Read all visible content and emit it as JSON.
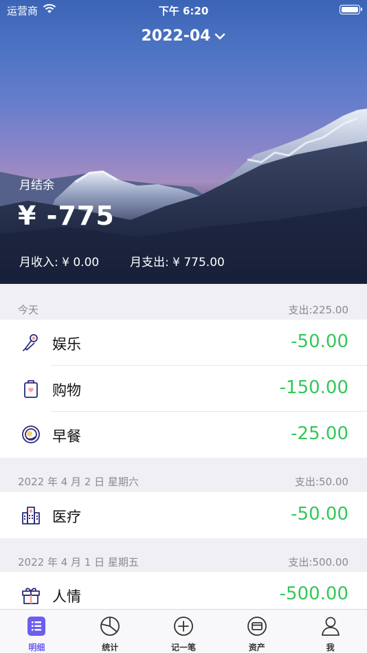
{
  "status_bar": {
    "carrier": "运营商",
    "time": "下午 6:20"
  },
  "header": {
    "month": "2022-04",
    "balance_label": "月结余",
    "balance_amount": "¥ -775",
    "income_text": "月收入: ¥ 0.00",
    "expense_text": "月支出: ¥ 775.00"
  },
  "sections": [
    {
      "date": "今天",
      "total": "支出:225.00",
      "rows": [
        {
          "icon": "microphone-icon",
          "name": "娱乐",
          "amount": "-50.00"
        },
        {
          "icon": "shopping-bag-icon",
          "name": "购物",
          "amount": "-150.00"
        },
        {
          "icon": "breakfast-plate-icon",
          "name": "早餐",
          "amount": "-25.00"
        }
      ]
    },
    {
      "date": "2022 年 4 月 2 日  星期六",
      "total": "支出:50.00",
      "rows": [
        {
          "icon": "hospital-icon",
          "name": "医疗",
          "amount": "-50.00"
        }
      ]
    },
    {
      "date": "2022 年 4 月 1 日  星期五",
      "total": "支出:500.00",
      "rows": [
        {
          "icon": "gift-icon",
          "name": "人情",
          "amount": "-500.00"
        }
      ]
    }
  ],
  "tabs": [
    {
      "label": "明细",
      "icon": "list-icon",
      "active": true
    },
    {
      "label": "统计",
      "icon": "pie-chart-icon",
      "active": false
    },
    {
      "label": "记一笔",
      "icon": "add-circle-icon",
      "active": false
    },
    {
      "label": "资产",
      "icon": "wallet-card-icon",
      "active": false
    },
    {
      "label": "我",
      "icon": "user-icon",
      "active": false
    }
  ],
  "colors": {
    "accent": "#6b5ef0",
    "amount_green": "#34c759",
    "icon_navy": "#2a2a7a"
  }
}
